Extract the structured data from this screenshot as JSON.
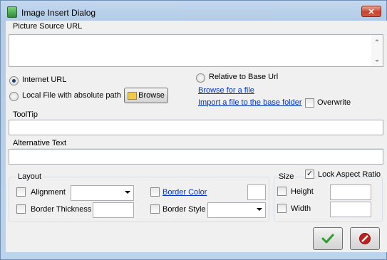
{
  "window": {
    "title": "Image Insert Dialog",
    "close_glyph": "✕"
  },
  "source": {
    "section_label": "Picture Source URL",
    "url_value": "",
    "internet_url_label": "Internet URL",
    "local_file_label": "Local File with absolute path",
    "browse_label": "Browse",
    "relative_label": "Relative to Base Url",
    "browse_file_link": "Browse for a file",
    "import_file_link": "Import a file to the base folder",
    "overwrite_label": "Overwrite",
    "selected": "internet_url",
    "overwrite_checked": false
  },
  "tooltip": {
    "label": "ToolTip",
    "value": ""
  },
  "alt_text": {
    "label": "Alternative Text",
    "value": ""
  },
  "layout": {
    "title": "Layout",
    "alignment_label": "Alignment",
    "alignment_value": "",
    "border_thickness_label": "Border Thickness",
    "border_thickness_value": "",
    "border_color_label": "Border Color",
    "border_style_label": "Border Style",
    "border_style_value": ""
  },
  "size": {
    "title": "Size",
    "lock_aspect_label": "Lock Aspect Ratio",
    "lock_aspect_checked": true,
    "height_label": "Height",
    "height_value": "",
    "width_label": "Width",
    "width_value": ""
  },
  "buttons": {
    "ok_icon": "check-icon",
    "cancel_icon": "cancel-icon"
  },
  "colors": {
    "link": "#0033cc",
    "ok": "#2e9e2e",
    "cancel": "#c0201d"
  }
}
